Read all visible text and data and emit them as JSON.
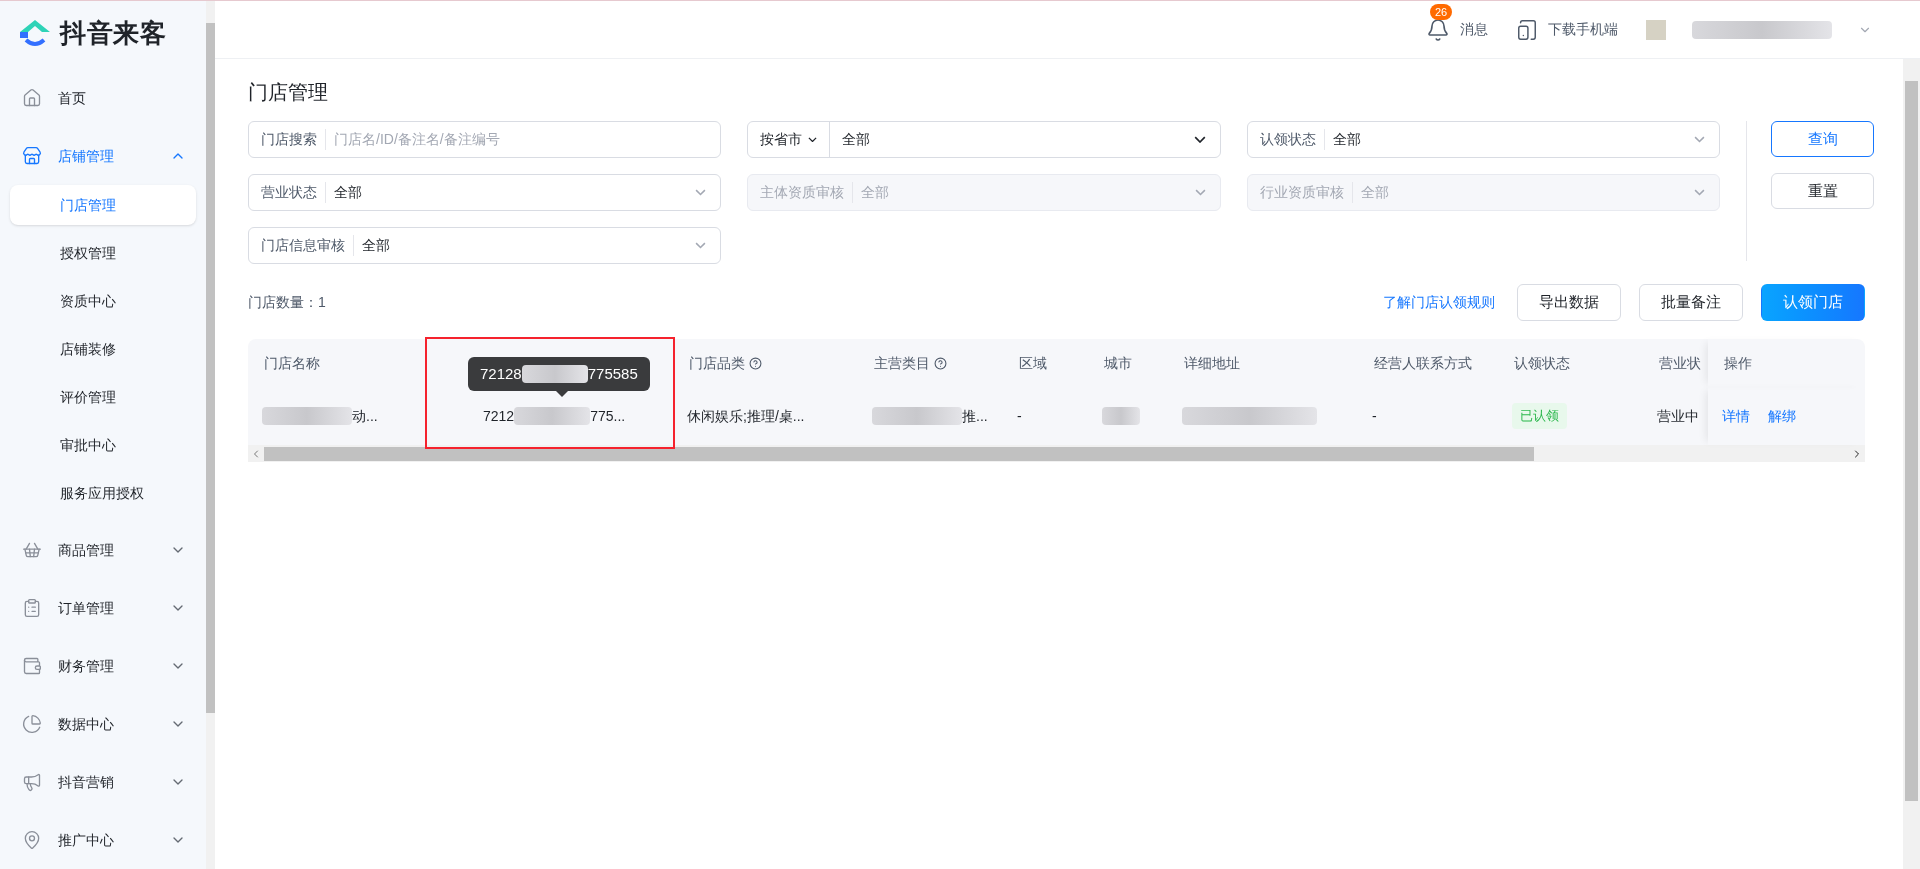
{
  "brand": {
    "name": "抖音来客"
  },
  "sidebar": {
    "items": [
      {
        "label": "首页",
        "selected": false
      },
      {
        "label": "店铺管理",
        "selected": true,
        "expanded": true,
        "children": [
          {
            "label": "门店管理",
            "selected": true
          },
          {
            "label": "授权管理",
            "selected": false
          },
          {
            "label": "资质中心",
            "selected": false
          },
          {
            "label": "店铺装修",
            "selected": false
          },
          {
            "label": "评价管理",
            "selected": false
          },
          {
            "label": "审批中心",
            "selected": false
          },
          {
            "label": "服务应用授权",
            "selected": false
          }
        ]
      },
      {
        "label": "商品管理",
        "selected": false,
        "expanded": false
      },
      {
        "label": "订单管理",
        "selected": false,
        "expanded": false
      },
      {
        "label": "财务管理",
        "selected": false,
        "expanded": false
      },
      {
        "label": "数据中心",
        "selected": false,
        "expanded": false
      },
      {
        "label": "抖音营销",
        "selected": false,
        "expanded": false
      },
      {
        "label": "推广中心",
        "selected": false,
        "expanded": false
      }
    ]
  },
  "header": {
    "messages": {
      "label": "消息",
      "badge": "26"
    },
    "download": {
      "label": "下载手机端"
    }
  },
  "page": {
    "title": "门店管理"
  },
  "filters": [
    {
      "kind": "search",
      "label": "门店搜索",
      "placeholder": "门店名/ID/备注名/备注编号",
      "disabled": false
    },
    {
      "kind": "region",
      "label": "按省市",
      "value": "全部",
      "disabled": false
    },
    {
      "kind": "select",
      "label": "认领状态",
      "value": "全部",
      "disabled": false
    },
    {
      "kind": "select",
      "label": "营业状态",
      "value": "全部",
      "disabled": false
    },
    {
      "kind": "select",
      "label": "主体资质审核",
      "value": "全部",
      "disabled": true
    },
    {
      "kind": "select",
      "label": "行业资质审核",
      "value": "全部",
      "disabled": true
    },
    {
      "kind": "select",
      "label": "门店信息审核",
      "value": "全部",
      "disabled": false
    }
  ],
  "filter_buttons": [
    {
      "label": "查询",
      "kind": "outline"
    },
    {
      "label": "重置",
      "kind": "plain"
    }
  ],
  "count": "门店数量：1",
  "actions": {
    "link": "了解门店认领规则",
    "buttons": [
      {
        "label": "导出数据",
        "kind": "plain"
      },
      {
        "label": "批量备注",
        "kind": "plain"
      },
      {
        "label": "认领门店",
        "kind": "primary"
      }
    ]
  },
  "table": {
    "columns": [
      {
        "kind": "plain",
        "label": "门店名称"
      },
      {
        "kind": "covered"
      },
      {
        "kind": "help",
        "label": "门店品类"
      },
      {
        "kind": "help",
        "label": "主营类目"
      },
      {
        "kind": "plain",
        "label": "区域"
      },
      {
        "kind": "plain",
        "label": "城市"
      },
      {
        "kind": "plain",
        "label": "详细地址"
      },
      {
        "kind": "plain",
        "label": "经营人联系方式"
      },
      {
        "kind": "plain",
        "label": "认领状态"
      },
      {
        "kind": "plain",
        "label": "营业状"
      },
      {
        "kind": "plain",
        "label": "操作"
      }
    ],
    "rows": [
      {
        "cells": [
          {
            "kind": "redacted",
            "suffix": "动..."
          },
          {
            "kind": "redacted",
            "prefix": "7212",
            "suffix": "775..."
          },
          {
            "kind": "text",
            "text": "休闲娱乐;推理/桌..."
          },
          {
            "kind": "redacted",
            "suffix": "推..."
          },
          {
            "kind": "text",
            "text": "-"
          },
          {
            "kind": "redacted"
          },
          {
            "kind": "redacted"
          },
          {
            "kind": "text",
            "text": "-"
          },
          {
            "kind": "badge",
            "text": "已认领"
          },
          {
            "kind": "text",
            "text": "营业中"
          },
          {
            "kind": "links",
            "links": [
              "详情",
              "解绑"
            ]
          }
        ]
      }
    ]
  },
  "tooltip": {
    "prefix": "72128",
    "suffix": "775585"
  }
}
